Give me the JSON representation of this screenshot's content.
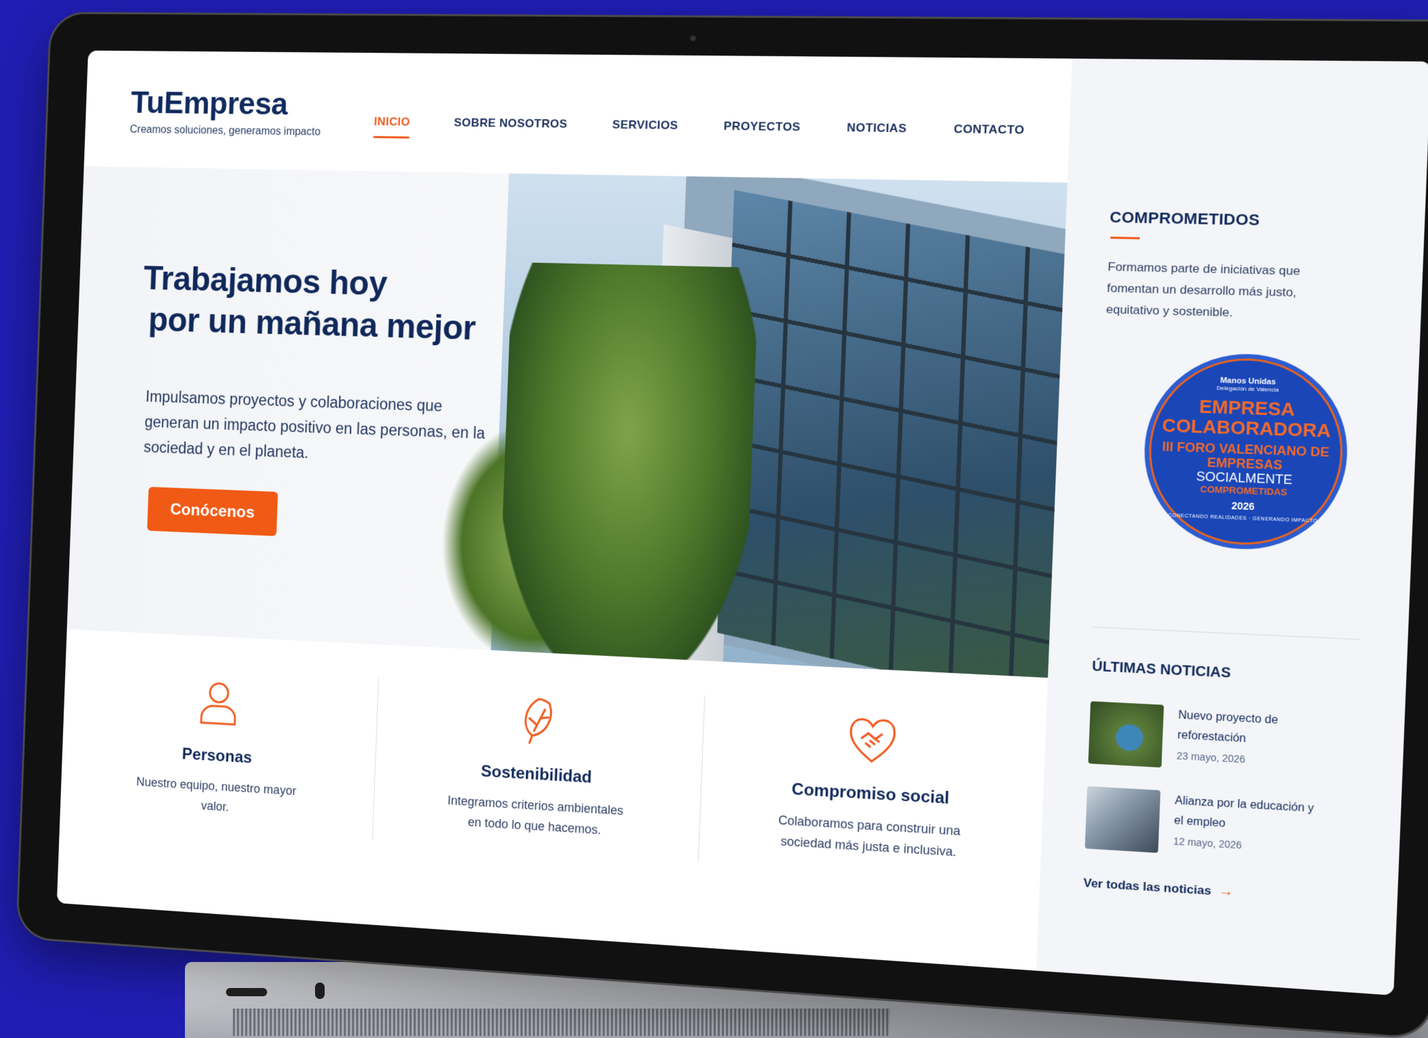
{
  "brand": {
    "name": "TuEmpresa",
    "tagline": "Creamos soluciones, generamos impacto"
  },
  "nav": [
    {
      "label": "INICIO",
      "active": true
    },
    {
      "label": "SOBRE NOSOTROS"
    },
    {
      "label": "SERVICIOS"
    },
    {
      "label": "PROYECTOS"
    },
    {
      "label": "NOTICIAS"
    },
    {
      "label": "CONTACTO"
    }
  ],
  "hero": {
    "title_line1": "Trabajamos hoy",
    "title_line2": "por un mañana mejor",
    "subtitle": "Impulsamos proyectos y colaboraciones que generan un impacto positivo en las personas, en la sociedad y en el planeta.",
    "cta": "Conócenos"
  },
  "values": [
    {
      "icon": "person-icon",
      "title": "Personas",
      "desc": "Nuestro equipo, nuestro mayor valor."
    },
    {
      "icon": "leaf-icon",
      "title": "Sostenibilidad",
      "desc": "Integramos criterios ambientales en todo lo que hacemos."
    },
    {
      "icon": "handshake-heart-icon",
      "title": "Compromiso social",
      "desc": "Colaboramos para construir una sociedad más justa e inclusiva."
    }
  ],
  "sidebar": {
    "title": "COMPROMETIDOS",
    "text": "Formamos parte de iniciativas que fomentan un desarrollo más justo, equitativo y sostenible.",
    "badge": {
      "org": "Manos Unidas",
      "org_sub": "Delegación de Valencia",
      "line1": "EMPRESA COLABORADORA",
      "line2": "III FORO VALENCIANO DE EMPRESAS",
      "line3": "SOCIALMENTE",
      "line4": "COMPROMETIDAS",
      "year": "2026",
      "motto": "CONECTANDO REALIDADES · GENERANDO IMPACTO"
    },
    "news_title": "ÚLTIMAS NOTICIAS",
    "news": [
      {
        "title": "Nuevo proyecto de reforestación",
        "date": "23 mayo, 2026"
      },
      {
        "title": "Alianza por la educación y el empleo",
        "date": "12 mayo, 2026"
      }
    ],
    "more": "Ver todas las noticias"
  },
  "colors": {
    "background": "#1f1db3",
    "accent": "#ee5a1e",
    "navy": "#10285a",
    "side_block": "#e8572a"
  }
}
